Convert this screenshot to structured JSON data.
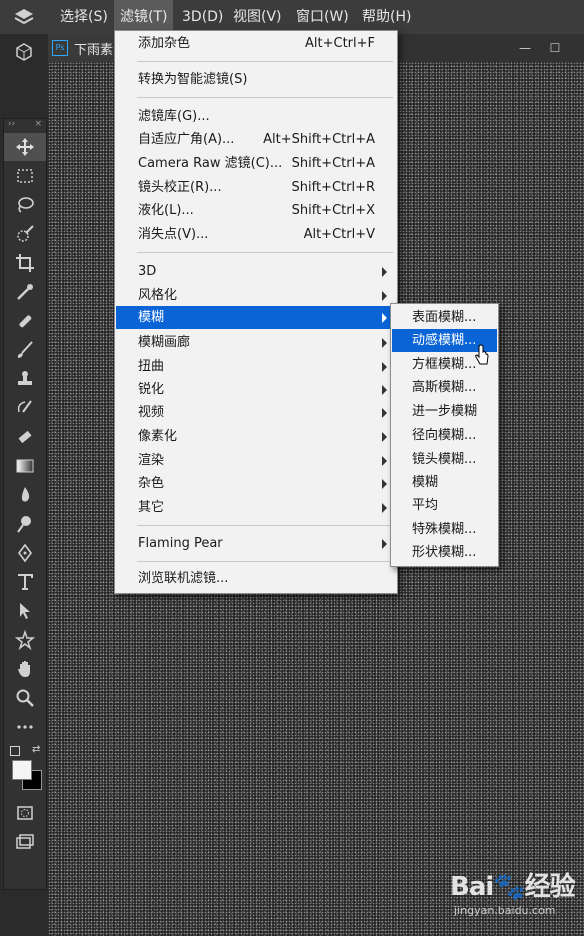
{
  "menubar": {
    "app_icon": "layers-icon",
    "items": [
      {
        "label": "选择(S)"
      },
      {
        "label": "滤镜(T)"
      },
      {
        "label": "3D(D)"
      },
      {
        "label": "视图(V)"
      },
      {
        "label": "窗口(W)"
      },
      {
        "label": "帮助(H)"
      }
    ]
  },
  "tab": {
    "icon_text": "Ps",
    "label": "下雨素"
  },
  "window_controls": {
    "minimize": "—",
    "maximize": "☐"
  },
  "toolbar_header": {
    "left": "››",
    "right": "×"
  },
  "filter_menu": {
    "items": [
      {
        "label": "添加杂色",
        "shortcut": "Alt+Ctrl+F"
      },
      {
        "label": "转换为智能滤镜(S)",
        "shortcut": ""
      },
      {
        "label": "滤镜库(G)...",
        "shortcut": ""
      },
      {
        "label": "自适应广角(A)...",
        "shortcut": "Alt+Shift+Ctrl+A"
      },
      {
        "label": "Camera Raw 滤镜(C)...",
        "shortcut": "Shift+Ctrl+A"
      },
      {
        "label": "镜头校正(R)...",
        "shortcut": "Shift+Ctrl+R"
      },
      {
        "label": "液化(L)...",
        "shortcut": "Shift+Ctrl+X"
      },
      {
        "label": "消失点(V)...",
        "shortcut": "Alt+Ctrl+V"
      },
      {
        "label": "3D"
      },
      {
        "label": "风格化"
      },
      {
        "label": "模糊"
      },
      {
        "label": "模糊画廊"
      },
      {
        "label": "扭曲"
      },
      {
        "label": "锐化"
      },
      {
        "label": "视频"
      },
      {
        "label": "像素化"
      },
      {
        "label": "渲染"
      },
      {
        "label": "杂色"
      },
      {
        "label": "其它"
      },
      {
        "label": "Flaming Pear"
      },
      {
        "label": "浏览联机滤镜..."
      }
    ]
  },
  "blur_submenu": {
    "items": [
      {
        "label": "表面模糊..."
      },
      {
        "label": "动感模糊..."
      },
      {
        "label": "方框模糊..."
      },
      {
        "label": "高斯模糊..."
      },
      {
        "label": "进一步模糊"
      },
      {
        "label": "径向模糊..."
      },
      {
        "label": "镜头模糊..."
      },
      {
        "label": "模糊"
      },
      {
        "label": "平均"
      },
      {
        "label": "特殊模糊..."
      },
      {
        "label": "形状模糊..."
      }
    ]
  },
  "watermark": {
    "logo": "Bai🐾经验",
    "url": "jingyan.baidu.com"
  },
  "colors": {
    "menu_highlight": "#0a64d6",
    "menu_bg": "#f2f2f2",
    "ui_dark": "#2b2b2b"
  }
}
